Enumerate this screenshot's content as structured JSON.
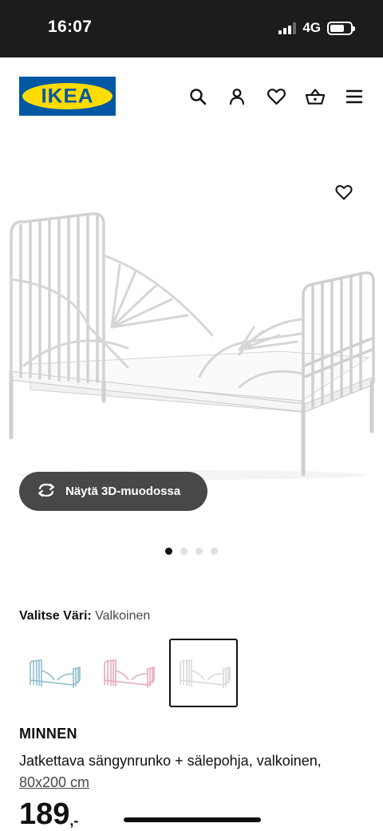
{
  "status_bar": {
    "time": "16:07",
    "network": "4G"
  },
  "header": {
    "logo_text": "IKEA",
    "icons": [
      "search-icon",
      "user-icon",
      "heart-icon",
      "basket-icon",
      "menu-icon"
    ]
  },
  "product_image": {
    "view_3d_label": "Näytä 3D-muodossa",
    "carousel_total": 4,
    "carousel_active": 1
  },
  "color_select": {
    "label": "Valitse Väri:",
    "value": "Valkoinen",
    "swatches": [
      {
        "color": "#8fbccb"
      },
      {
        "color": "#e7a9bd"
      },
      {
        "color": "#e9e9e9"
      }
    ]
  },
  "product": {
    "name": "MINNEN",
    "description": "Jatkettava sängynrunko + sälepohja, valkoinen,",
    "size": "80x200 cm",
    "price_int": "189",
    "price_dec": ",-"
  },
  "colors": {
    "brand_blue": "#0058a3",
    "brand_yellow": "#ffdb00",
    "button_dark": "#484848"
  }
}
